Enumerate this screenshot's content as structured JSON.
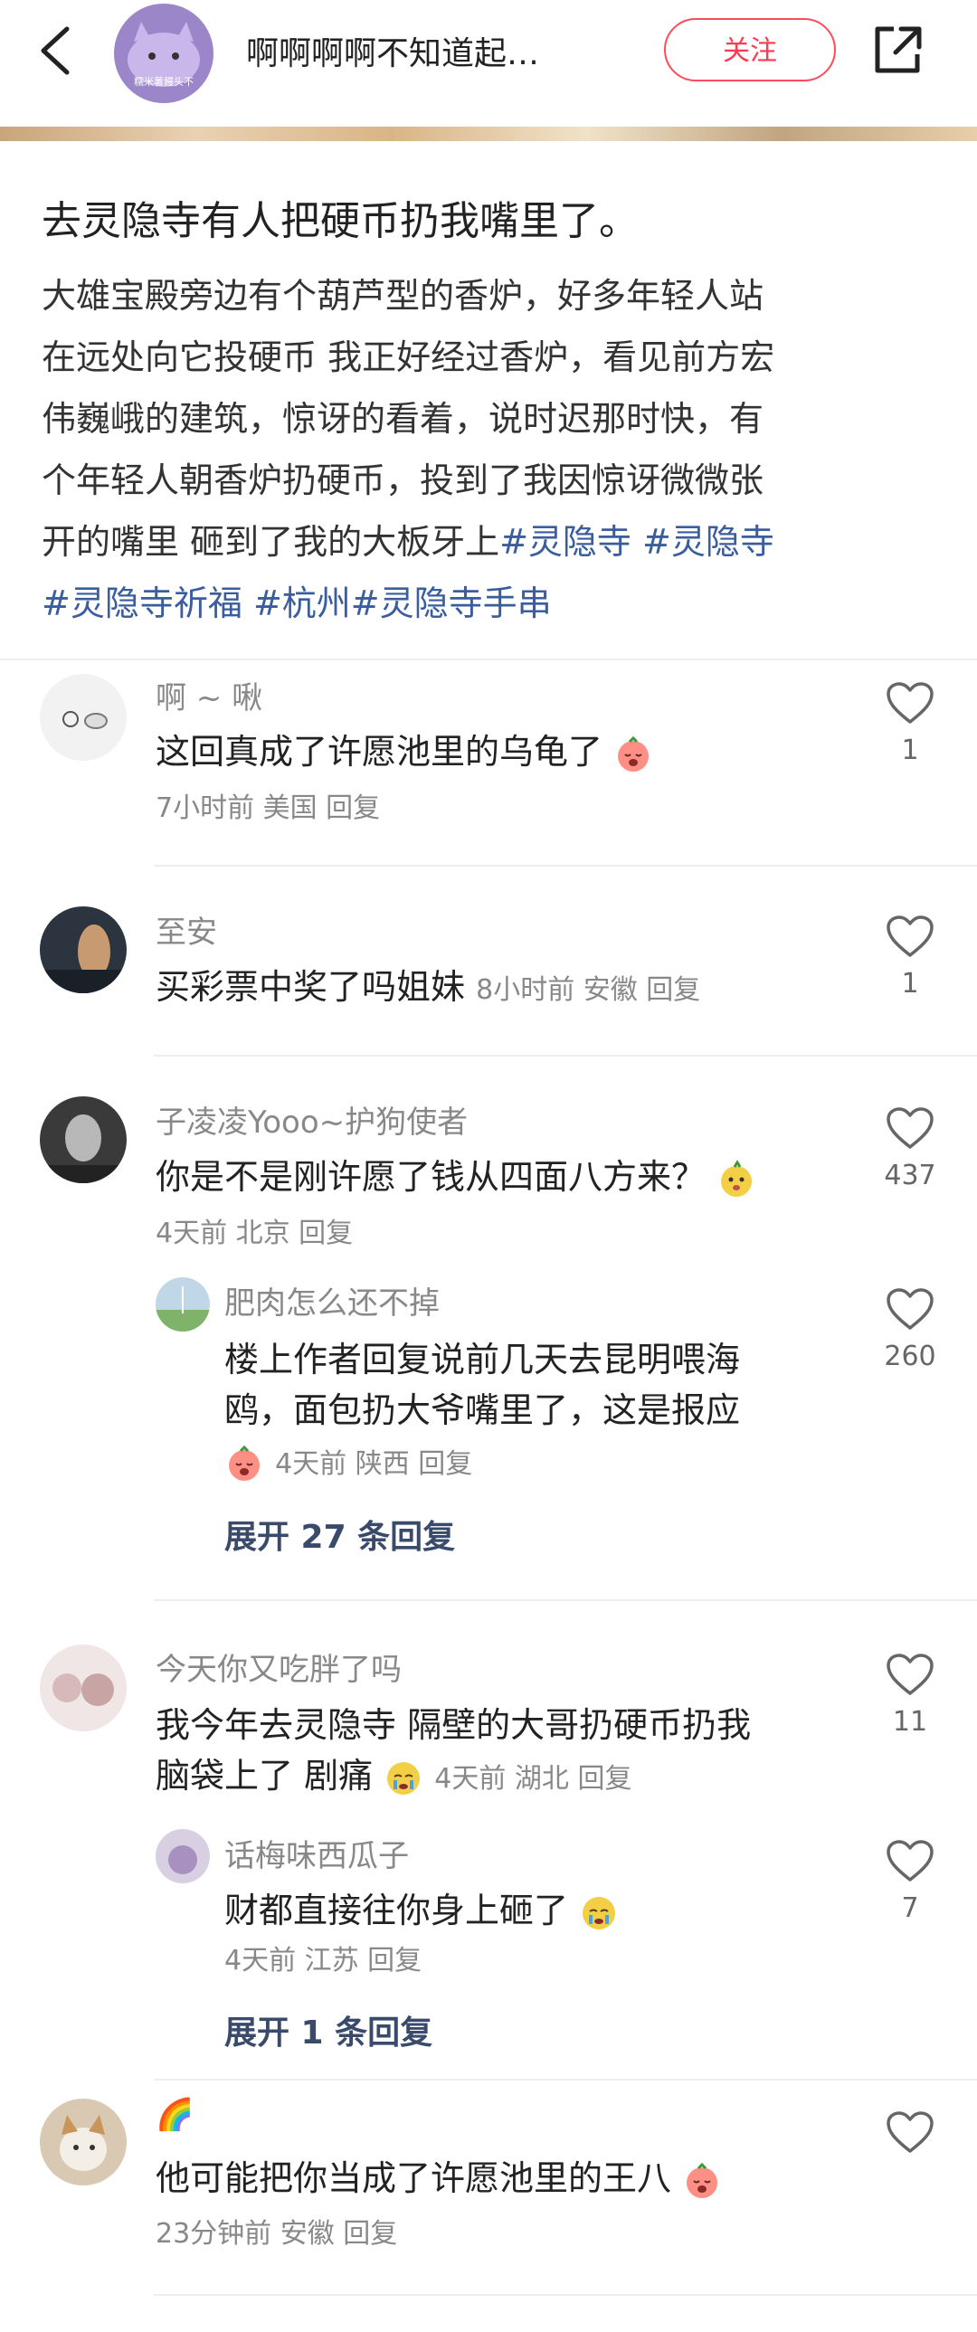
{
  "header": {
    "author": "啊啊啊啊不知道起…",
    "follow_label": "关注",
    "avatar_caption": "糯米薯饅头不"
  },
  "post": {
    "title": "去灵隐寺有人把硬币扔我嘴里了。",
    "body_lines": [
      "大雄宝殿旁边有个葫芦型的香炉，好多年轻人站",
      "在远处向它投硬币 我正好经过香炉，看见前方宏",
      "伟巍峨的建筑，惊讶的看着，说时迟那时快，有",
      "个年轻人朝香炉扔硬币，投到了我因惊讶微微张",
      "开的嘴里 砸到了我的大板牙上"
    ],
    "tags": [
      "#灵隐寺",
      "#灵隐寺",
      "#灵隐寺祈福",
      "#杭州",
      "#灵隐寺手串"
    ]
  },
  "comments": [
    {
      "user": "啊 ~ 啾",
      "text": "这回真成了许愿池里的乌龟了",
      "meta": "7小时前  美国  回复",
      "likes": "1"
    },
    {
      "user": "至安",
      "text": "买彩票中奖了吗姐妹",
      "meta": "8小时前  安徽  回复",
      "likes": "1"
    },
    {
      "user": "子凌凌Yooo~护狗使者",
      "text": "你是不是刚许愿了钱从四面八方来？",
      "meta": "4天前  北京  回复",
      "likes": "437",
      "reply": {
        "user": "肥肉怎么还不掉",
        "line1": "楼上作者回复说前几天去昆明喂海",
        "line2": "鸥，面包扔大爷嘴里了，这是报应",
        "meta": "4天前  陕西  回复",
        "likes": "260"
      },
      "expand": "展开 27 条回复"
    },
    {
      "user": "今天你又吃胖了吗",
      "line1": "我今年去灵隐寺 隔壁的大哥扔硬币扔我",
      "line2": "脑袋上了 剧痛",
      "meta": "4天前  湖北  回复",
      "likes": "11",
      "reply": {
        "user": "话梅味西瓜子",
        "text": "财都直接往你身上砸了",
        "meta": "4天前  江苏  回复",
        "likes": "7"
      },
      "expand": "展开 1 条回复"
    },
    {
      "user": "🌈",
      "text": "他可能把你当成了许愿池里的王八",
      "meta": "23分钟前  安徽  回复",
      "likes": ""
    }
  ]
}
